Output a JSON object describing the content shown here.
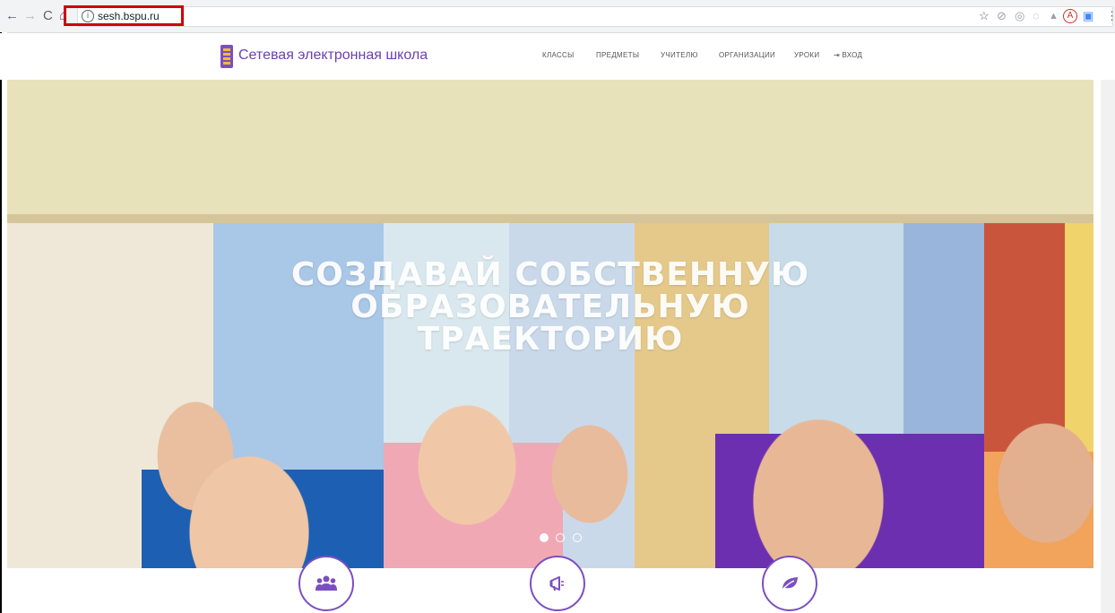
{
  "browser": {
    "url": "sesh.bspu.ru",
    "nav": {
      "back": "←",
      "forward": "→",
      "reload": "C",
      "home": "⌂"
    },
    "info_icon": "i",
    "extensions": [
      "star-icon",
      "extension-icon",
      "extension-icon",
      "extension-icon",
      "extension-icon",
      "adblock-icon",
      "extension-icon",
      "menu-icon"
    ],
    "ext_glyphs": {
      "star": "☆",
      "e1": "⊘",
      "e2": "◎",
      "e3": "◌",
      "e4": "▲",
      "e5": "A",
      "e6": "▣",
      "menu": "⋮"
    }
  },
  "header": {
    "brand": "Сетевая электронная школа",
    "menu": [
      "КЛАССЫ",
      "ПРЕДМЕТЫ",
      "УЧИТЕЛЮ",
      "ОРГАНИЗАЦИИ",
      "УРОКИ",
      "⇥ ВХОД"
    ]
  },
  "hero": {
    "title_lines": [
      "СОЗДАВАЙ СОБСТВЕННУЮ",
      "ОБРАЗОВАТЕЛЬНУЮ",
      "ТРАЕКТОРИЮ"
    ],
    "slides": 3,
    "active_slide": 1
  },
  "features": [
    {
      "icon": "users-icon"
    },
    {
      "icon": "bullhorn-icon"
    },
    {
      "icon": "leaf-icon"
    }
  ],
  "colors": {
    "accent": "#6a3fb5",
    "highlight": "#d00000"
  }
}
